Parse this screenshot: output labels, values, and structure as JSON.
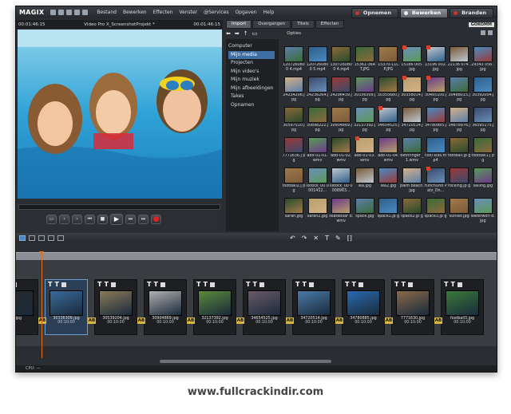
{
  "app": {
    "logo": "MAGIX"
  },
  "menu": [
    "Bestand",
    "Bewerken",
    "Effecten",
    "Venster",
    "@Services",
    "Opgaven",
    "Help"
  ],
  "modes": [
    {
      "label": "Opnemen",
      "active": false
    },
    {
      "label": "Bewerken",
      "active": true
    },
    {
      "label": "Branden",
      "active": false
    }
  ],
  "preview": {
    "time_left": "00:01:46:15",
    "title": "Video Pro X_ScreenshotProjekt *",
    "time_right": "00:01:46:15"
  },
  "media": {
    "tabs": [
      {
        "label": "Import",
        "active": true
      },
      {
        "label": "Overgangen",
        "active": false
      },
      {
        "label": "Titels",
        "active": false
      },
      {
        "label": "Effecten",
        "active": false
      }
    ],
    "options_label": "Opties",
    "gokomm": "GOKOMM",
    "nav": [
      {
        "label": "Computer",
        "sub": false,
        "selected": false
      },
      {
        "label": "Mijn media",
        "sub": false,
        "selected": true
      },
      {
        "label": "Projecten",
        "sub": true,
        "selected": false
      },
      {
        "label": "Mijn video's",
        "sub": true,
        "selected": false
      },
      {
        "label": "Mijn muziek",
        "sub": true,
        "selected": false
      },
      {
        "label": "Mijn afbeeldingen",
        "sub": true,
        "selected": false
      },
      {
        "label": "Takes",
        "sub": true,
        "selected": false
      },
      {
        "label": "Opnamen",
        "sub": true,
        "selected": false
      }
    ],
    "items": [
      "1207260800 4.mp4",
      "1207260800 5.mp4",
      "1307260800 4.mp4",
      "15361-36A T.JPG",
      "15370-11C P.JPG",
      "15186 005. jpg",
      "13196 002. jpg",
      "22136 074 .jpg",
      "29343 056 .jpg",
      "24234206.j pg",
      "24236264.j pg",
      "24296439.j pg",
      "30336309.j pg",
      "30355680.j pg",
      "30358014.j pg",
      "30465100.j pg",
      "30488015.j pg",
      "30392004.j pg",
      "30597510.j pg",
      "30898222.j pg",
      "30904869.j pg",
      "32137392.j pg",
      "34654525.j pg",
      "34720514.j pg",
      "34780885.j pg",
      "34878976.j pg",
      "36595175.j pg",
      "7771636.j pg",
      "ado-01-01. wmv",
      "ado-01-02. wmv",
      "ado-01-03. wmv",
      "ado-01-04. wmv",
      "bethringer _1.wmv",
      "cool kids.mp4",
      "football.jp g",
      "football1.j pg",
      "football2.j pg",
      "ilstock_00 0001412...",
      "ilstock_00 0008963...",
      "lea.jpg",
      "lea2.jpg",
      "palm beach.jpg",
      "FunchUnd Patz_On...",
      "rocking.jp g",
      "sailing.jpg",
      "sarah.jpg",
      "sarah2.jpg",
      "skateboar d.wmv",
      "space.jpg",
      "space1.jp g",
      "space2.jp g",
      "space3.jp g",
      "sunset.jpg",
      "waterworl d.jpg"
    ]
  },
  "timeline": {
    "clips": [
      {
        "name": "0.jpg",
        "time": ""
      },
      {
        "name": "30336309.jpg",
        "time": "00:10:00"
      },
      {
        "name": "30539204.jpg",
        "time": "00:10:00"
      },
      {
        "name": "30904869.jpg",
        "time": "00:10:00"
      },
      {
        "name": "32137392.jpg",
        "time": "00:10:00"
      },
      {
        "name": "34654525.jpg",
        "time": "00:10:00"
      },
      {
        "name": "34720514.jpg",
        "time": "00:10:00"
      },
      {
        "name": "34780885.jpg",
        "time": "00:10:00"
      },
      {
        "name": "7771630.jpg",
        "time": "00:10:00"
      },
      {
        "name": "football3.jpg",
        "time": "00:10:00"
      }
    ]
  },
  "status": {
    "cpu": "CPU: —"
  },
  "watermark": "www.fullcrackindir.com"
}
